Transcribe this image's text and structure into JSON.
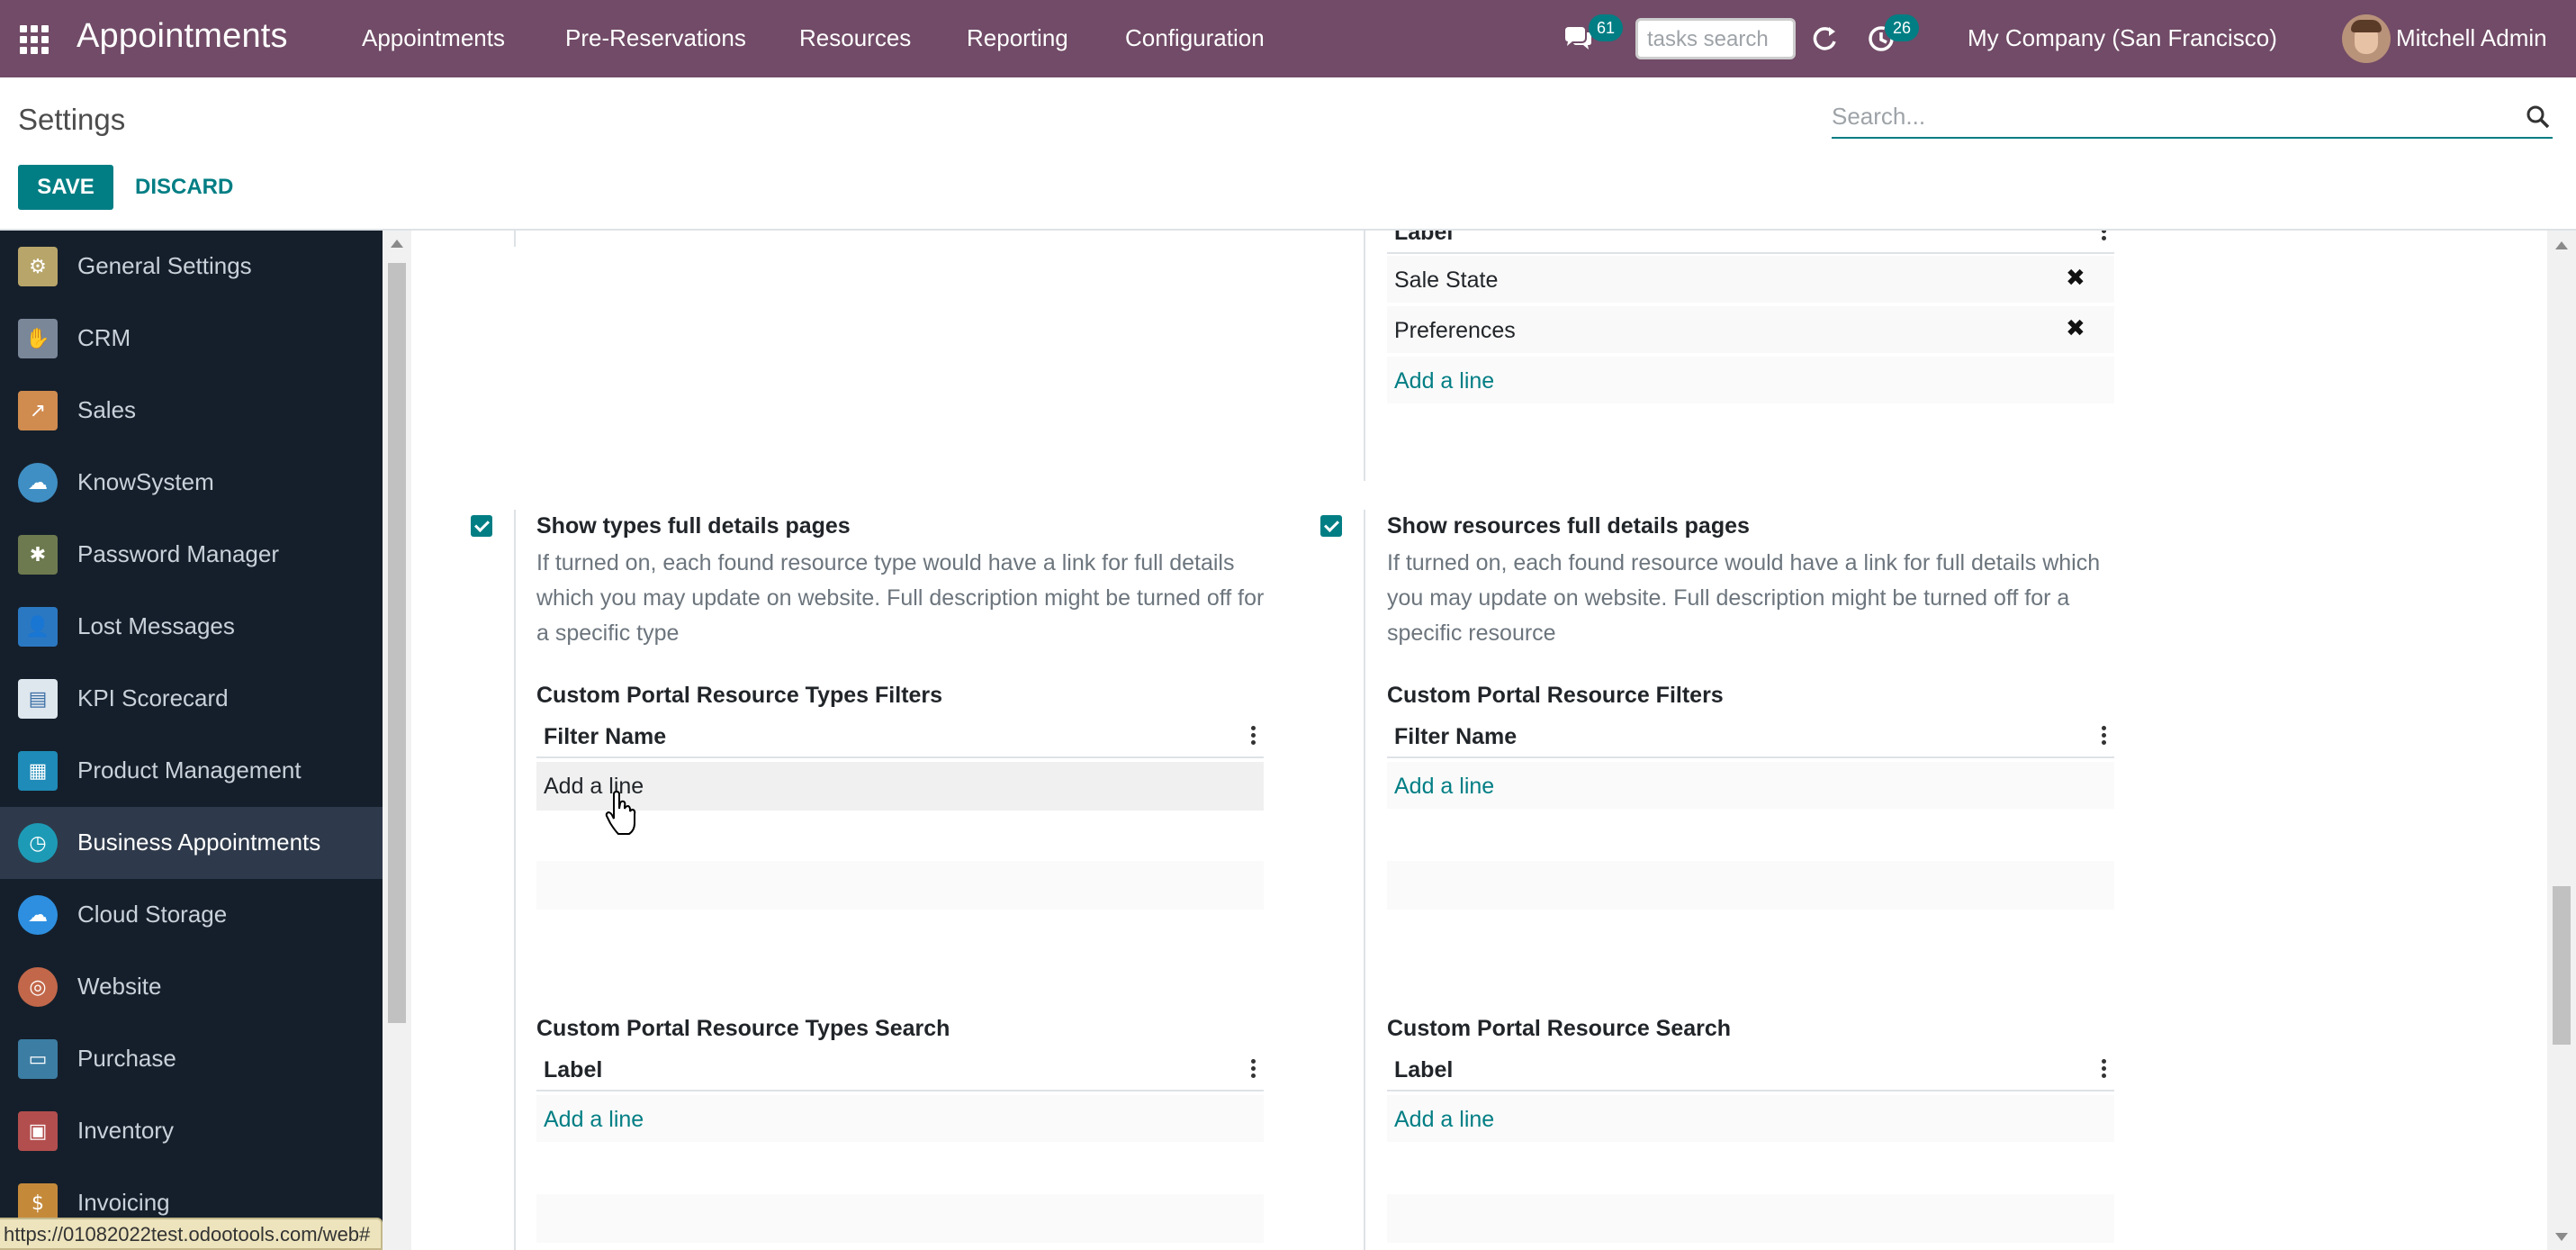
{
  "topbar": {
    "brand": "Appointments",
    "menu": [
      "Appointments",
      "Pre-Reservations",
      "Resources",
      "Reporting",
      "Configuration"
    ],
    "chat_badge": "61",
    "search_placeholder": "tasks search",
    "activity_badge": "26",
    "company": "My Company (San Francisco)",
    "user": "Mitchell Admin",
    "bg_color": "#714b67"
  },
  "control_panel": {
    "title": "Settings",
    "search_placeholder": "Search...",
    "save_label": "SAVE",
    "discard_label": "DISCARD"
  },
  "sidebar": {
    "items": [
      {
        "label": "General Settings",
        "icon": "gear-icon",
        "active": false
      },
      {
        "label": "CRM",
        "icon": "handshake-icon",
        "active": false
      },
      {
        "label": "Sales",
        "icon": "chart-icon",
        "active": false
      },
      {
        "label": "KnowSystem",
        "icon": "brain-icon",
        "active": false
      },
      {
        "label": "Password Manager",
        "icon": "key-icon",
        "active": false
      },
      {
        "label": "Lost Messages",
        "icon": "user-question-icon",
        "active": false
      },
      {
        "label": "KPI Scorecard",
        "icon": "scorecard-icon",
        "active": false
      },
      {
        "label": "Product Management",
        "icon": "product-icon",
        "active": false
      },
      {
        "label": "Business Appointments",
        "icon": "clock-icon",
        "active": true
      },
      {
        "label": "Cloud Storage",
        "icon": "cloud-icon",
        "active": false
      },
      {
        "label": "Website",
        "icon": "globe-icon",
        "active": false
      },
      {
        "label": "Purchase",
        "icon": "card-icon",
        "active": false
      },
      {
        "label": "Inventory",
        "icon": "box-icon",
        "active": false
      },
      {
        "label": "Invoicing",
        "icon": "invoice-icon",
        "active": false
      }
    ]
  },
  "top_right_list": {
    "header": "Label",
    "rows": [
      "Sale State",
      "Preferences"
    ],
    "add_line": "Add a line"
  },
  "left_section": {
    "title": "Show types full details pages",
    "checked": true,
    "description": "If turned on, each found resource type would have a link for full details which you may update on website. Full description might be turned off for a specific type",
    "filters_title": "Custom Portal Resource Types Filters",
    "filters_header": "Filter Name",
    "filters_add": "Add a line",
    "search_title": "Custom Portal Resource Types Search",
    "search_header": "Label",
    "search_add": "Add a line"
  },
  "right_section": {
    "title": "Show resources full details pages",
    "checked": true,
    "description": "If turned on, each found resource would have a link for full details which you may update on website. Full description might be turned off for a specific resource",
    "filters_title": "Custom Portal Resource Filters",
    "filters_header": "Filter Name",
    "filters_add": "Add a line",
    "search_title": "Custom Portal Resource Search",
    "search_header": "Label",
    "search_add": "Add a line"
  },
  "status_url": "https://01082022test.odootools.com/web#"
}
